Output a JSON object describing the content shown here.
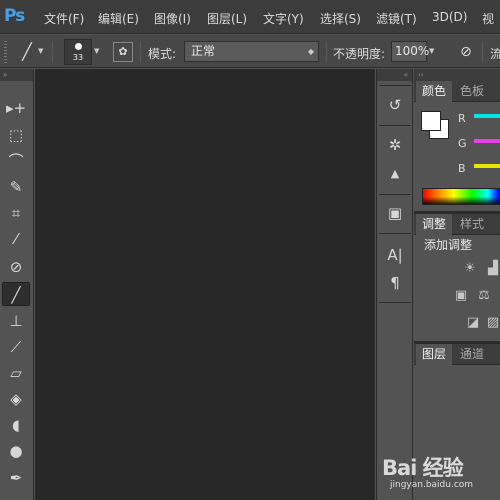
{
  "app": {
    "logo": "Ps"
  },
  "menu": [
    {
      "label": "文件(F)"
    },
    {
      "label": "编辑(E)"
    },
    {
      "label": "图像(I)"
    },
    {
      "label": "图层(L)"
    },
    {
      "label": "文字(Y)"
    },
    {
      "label": "选择(S)"
    },
    {
      "label": "滤镜(T)"
    },
    {
      "label": "3D(D)"
    },
    {
      "label": "视"
    }
  ],
  "options": {
    "brush_size": "33",
    "mode_label": "模式:",
    "mode_value": "正常",
    "opacity_label": "不透明度:",
    "opacity_value": "100%",
    "flow_label_partial": "流"
  },
  "tools_panel": {
    "collapse": "»",
    "tools": [
      {
        "icon": "move-tool-icon",
        "glyph": "▸+"
      },
      {
        "icon": "marquee-tool-icon",
        "glyph": "⬚"
      },
      {
        "icon": "lasso-tool-icon",
        "glyph": "⌒"
      },
      {
        "icon": "quick-selection-tool-icon",
        "glyph": "✎"
      },
      {
        "icon": "crop-tool-icon",
        "glyph": "⌗"
      },
      {
        "icon": "eyedropper-tool-icon",
        "glyph": "⁄"
      },
      {
        "icon": "healing-brush-tool-icon",
        "glyph": "⊘"
      },
      {
        "icon": "brush-tool-icon",
        "glyph": "╱",
        "active": true
      },
      {
        "icon": "clone-stamp-tool-icon",
        "glyph": "⊥"
      },
      {
        "icon": "history-brush-tool-icon",
        "glyph": "⟋"
      },
      {
        "icon": "eraser-tool-icon",
        "glyph": "▱"
      },
      {
        "icon": "paint-bucket-tool-icon",
        "glyph": "◈"
      },
      {
        "icon": "blur-tool-icon",
        "glyph": "◖"
      },
      {
        "icon": "dodge-tool-icon",
        "glyph": "●"
      },
      {
        "icon": "pen-tool-icon",
        "glyph": "✒"
      }
    ]
  },
  "icon_strip": {
    "collapse": "«",
    "icons": [
      {
        "icon": "history-panel-icon",
        "glyph": "↺"
      },
      {
        "icon": "navigator-panel-icon",
        "glyph": "✲"
      },
      {
        "icon": "histogram-panel-icon",
        "glyph": "▲"
      },
      {
        "icon": "info-panel-icon",
        "glyph": "▣"
      },
      {
        "icon": "character-panel-icon",
        "glyph": "A|"
      },
      {
        "icon": "paragraph-panel-icon",
        "glyph": "¶"
      }
    ]
  },
  "color_panel": {
    "tabs": [
      "颜色",
      "色板"
    ],
    "channels": [
      {
        "label": "R",
        "color": "#00e6e6"
      },
      {
        "label": "G",
        "color": "#e640e6"
      },
      {
        "label": "B",
        "color": "#e6e600"
      }
    ],
    "foreground": "#ffffff",
    "background": "#ffffff"
  },
  "adjustments_panel": {
    "tabs": [
      "调整",
      "样式"
    ],
    "title": "添加调整"
  },
  "layers_panel": {
    "tabs": [
      "图层",
      "通道"
    ]
  },
  "watermark": {
    "brand": "Bai 经验",
    "url": "jingyan.baidu.com"
  }
}
